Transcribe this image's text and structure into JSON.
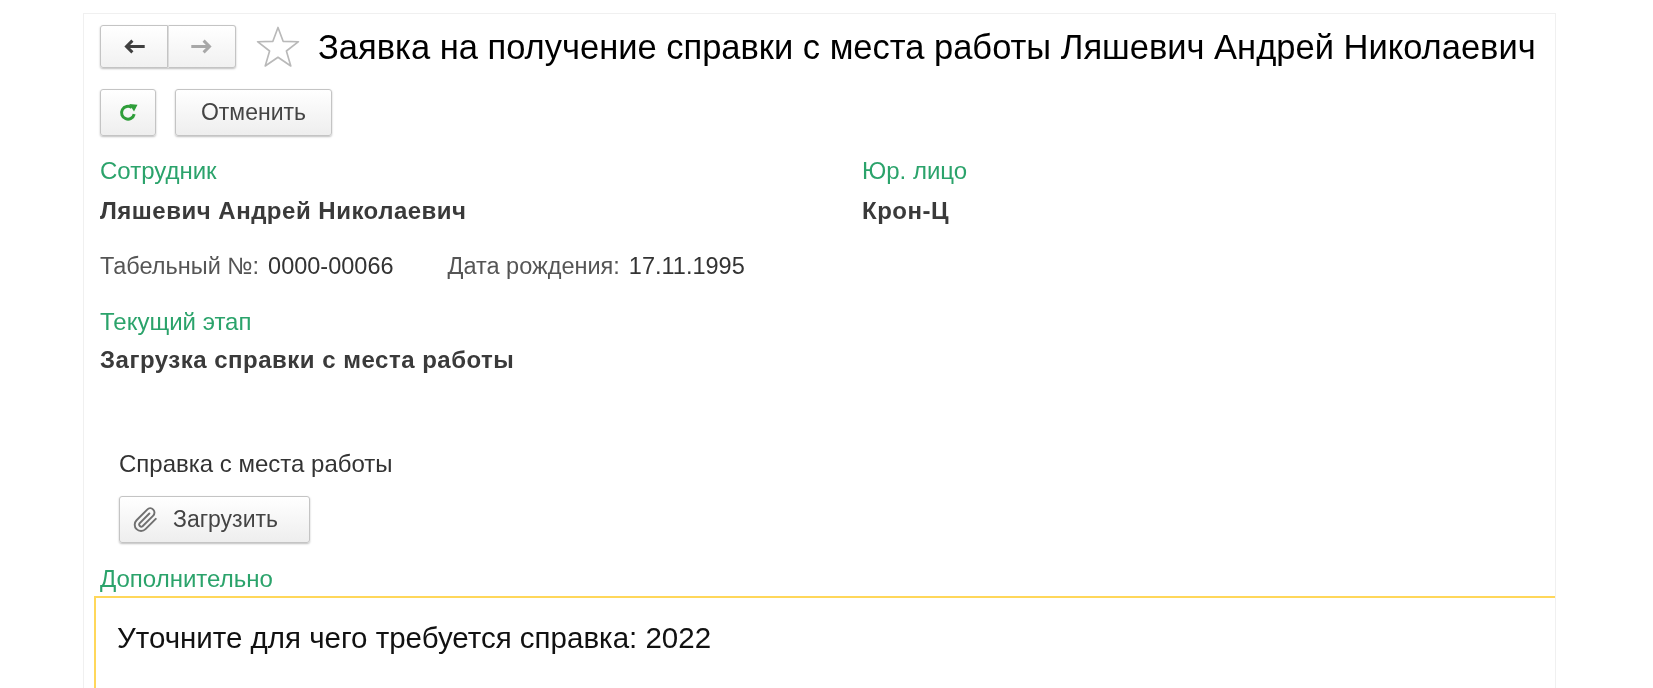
{
  "window": {
    "title": "Заявка на получение справки с места работы Ляшевич Андрей Николаевич",
    "starred": false
  },
  "navigation": [
    {
      "kind": "back",
      "disabled": false
    },
    {
      "kind": "forward",
      "disabled": true
    }
  ],
  "toolbar": [
    {
      "kind": "refresh"
    },
    {
      "kind": "text",
      "label": "Отменить"
    }
  ],
  "fields": [
    {
      "label": "Сотрудник",
      "value": "Ляшевич Андрей Николаевич"
    },
    {
      "label": "Юр. лицо",
      "value": "Крон-Ц"
    }
  ],
  "details": [
    {
      "label": "Табельный №:",
      "value": "0000-00066"
    },
    {
      "label": "Дата рождения:",
      "value": "17.11.1995"
    }
  ],
  "stage": {
    "label": "Текущий этап",
    "value": "Загрузка справки с места работы"
  },
  "attachment": {
    "label": "Справка с места работы",
    "button": "Загрузить"
  },
  "additional": {
    "label": "Дополнительно",
    "value": "Уточните для чего требуется справка: 2022",
    "focused": true
  }
}
